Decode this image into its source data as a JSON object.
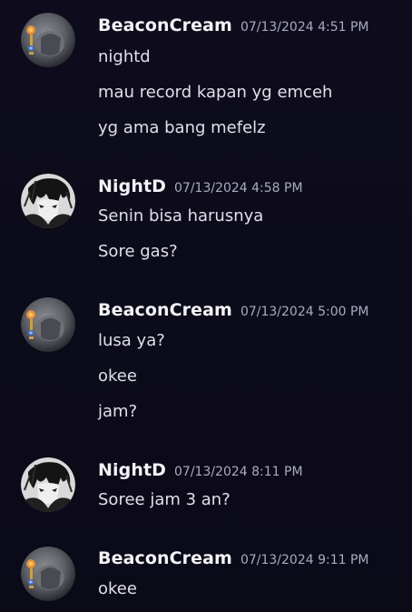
{
  "messages": [
    {
      "author": "BeaconCream",
      "timestamp": "07/13/2024 4:51 PM",
      "avatar": "beaconcream-avatar",
      "lines": [
        "nightd",
        "mau record kapan yg emceh",
        "yg ama bang mefelz"
      ]
    },
    {
      "author": "NightD",
      "timestamp": "07/13/2024 4:58 PM",
      "avatar": "nightd-avatar",
      "lines": [
        "Senin bisa harusnya",
        "Sore gas?"
      ]
    },
    {
      "author": "BeaconCream",
      "timestamp": "07/13/2024 5:00 PM",
      "avatar": "beaconcream-avatar",
      "lines": [
        "lusa ya?",
        "okee",
        "jam?"
      ]
    },
    {
      "author": "NightD",
      "timestamp": "07/13/2024 8:11 PM",
      "avatar": "nightd-avatar",
      "lines": [
        "Soree jam 3 an?"
      ]
    },
    {
      "author": "BeaconCream",
      "timestamp": "07/13/2024 9:11 PM",
      "avatar": "beaconcream-avatar",
      "lines": [
        "okee"
      ]
    }
  ],
  "colors": {
    "background": "#0d0b1b",
    "username": "#f2f3f7",
    "timestamp": "#a8abc0",
    "message_text": "#dfe0e8"
  }
}
